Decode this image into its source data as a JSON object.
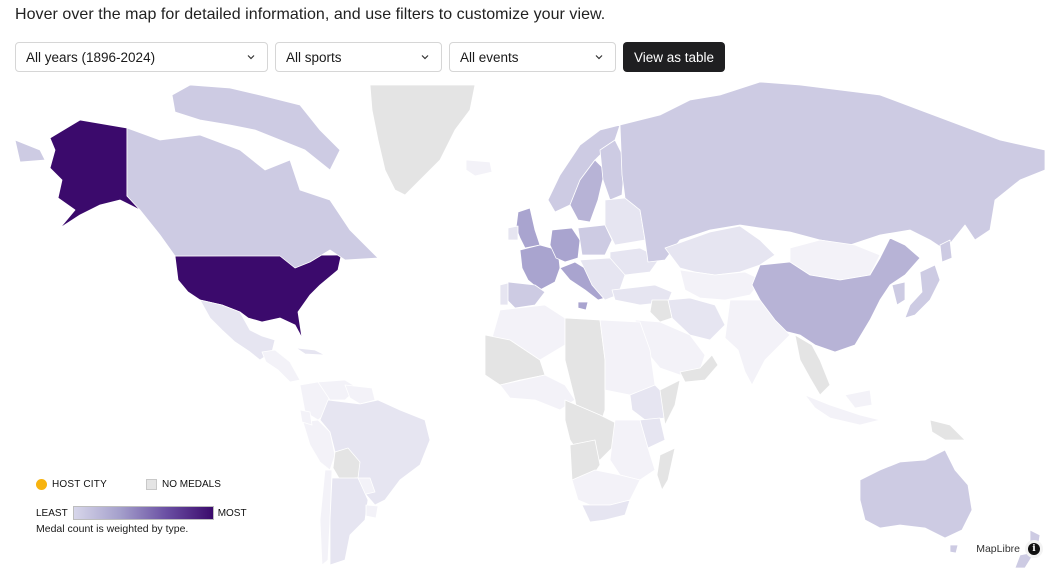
{
  "intro_text": "Hover over the map for detailed information, and use filters to customize your view.",
  "filters": {
    "years": {
      "selected": "All years (1896-2024)"
    },
    "sports": {
      "selected": "All sports"
    },
    "events": {
      "selected": "All events"
    },
    "view_table_label": "View as table"
  },
  "legend": {
    "host_city_label": "HOST CITY",
    "no_medals_label": "NO MEDALS",
    "least_label": "LEAST",
    "most_label": "MOST",
    "note": "Medal count is weighted by type."
  },
  "colors": {
    "host_city": "#f7b30f",
    "no_medals": "#e4e4e4",
    "scale": [
      "#f3f2f8",
      "#e6e5f1",
      "#cdcbe3",
      "#b7b3d6",
      "#a9a4cf",
      "#3b0a6c"
    ]
  },
  "attribution": {
    "label": "MapLibre",
    "info_icon": "i"
  },
  "countries": [
    {
      "name": "United States",
      "level": 5
    },
    {
      "name": "Alaska (United States)",
      "level": 5
    },
    {
      "name": "Canada",
      "level": 2
    },
    {
      "name": "Canadian Arctic Islands",
      "level": 2
    },
    {
      "name": "Greenland",
      "level": -1
    },
    {
      "name": "Iceland",
      "level": 0
    },
    {
      "name": "Mexico",
      "level": 1
    },
    {
      "name": "Central America",
      "level": 0
    },
    {
      "name": "Cuba",
      "level": 1
    },
    {
      "name": "Colombia",
      "level": 0
    },
    {
      "name": "Venezuela",
      "level": 0
    },
    {
      "name": "Guyana-Suriname",
      "level": 0
    },
    {
      "name": "Peru",
      "level": 0
    },
    {
      "name": "Ecuador",
      "level": 0
    },
    {
      "name": "Brazil",
      "level": 1
    },
    {
      "name": "Bolivia",
      "level": -1
    },
    {
      "name": "Paraguay",
      "level": 0
    },
    {
      "name": "Chile",
      "level": 0
    },
    {
      "name": "Argentina",
      "level": 1
    },
    {
      "name": "Uruguay",
      "level": 0
    },
    {
      "name": "United Kingdom",
      "level": 4
    },
    {
      "name": "Ireland",
      "level": 1
    },
    {
      "name": "France",
      "level": 4
    },
    {
      "name": "Spain",
      "level": 2
    },
    {
      "name": "Portugal",
      "level": 1
    },
    {
      "name": "Germany",
      "level": 4
    },
    {
      "name": "Italy",
      "level": 4
    },
    {
      "name": "Norway",
      "level": 2
    },
    {
      "name": "Sweden",
      "level": 3
    },
    {
      "name": "Finland",
      "level": 2
    },
    {
      "name": "Poland",
      "level": 2
    },
    {
      "name": "Ukraine",
      "level": 1
    },
    {
      "name": "Eastern Europe",
      "level": 1
    },
    {
      "name": "Balkans",
      "level": 1
    },
    {
      "name": "Turkey",
      "level": 1
    },
    {
      "name": "Russia",
      "level": 2
    },
    {
      "name": "Kazakhstan",
      "level": 1
    },
    {
      "name": "Central Asia",
      "level": 0
    },
    {
      "name": "Mongolia",
      "level": 0
    },
    {
      "name": "China",
      "level": 3
    },
    {
      "name": "Korea",
      "level": 2
    },
    {
      "name": "Japan",
      "level": 2
    },
    {
      "name": "Iran",
      "level": 1
    },
    {
      "name": "Iraq",
      "level": -1
    },
    {
      "name": "Arabia",
      "level": 0
    },
    {
      "name": "Yemen-Oman",
      "level": -1
    },
    {
      "name": "India",
      "level": 0
    },
    {
      "name": "Southeast Asia",
      "level": -1
    },
    {
      "name": "Indonesia",
      "level": 0
    },
    {
      "name": "Papua New Guinea",
      "level": -1
    },
    {
      "name": "Australia",
      "level": 2
    },
    {
      "name": "New Zealand",
      "level": 2
    },
    {
      "name": "North Africa West",
      "level": 0
    },
    {
      "name": "Libya-Chad",
      "level": -1
    },
    {
      "name": "Egypt-Sudan",
      "level": 0
    },
    {
      "name": "West Africa",
      "level": -1
    },
    {
      "name": "West Africa Coast",
      "level": 0
    },
    {
      "name": "Central Africa",
      "level": -1
    },
    {
      "name": "Ethiopia",
      "level": 1
    },
    {
      "name": "Kenya",
      "level": 1
    },
    {
      "name": "Somalia",
      "level": -1
    },
    {
      "name": "East Africa",
      "level": 0
    },
    {
      "name": "Angola",
      "level": -1
    },
    {
      "name": "Southern Africa",
      "level": 0
    },
    {
      "name": "South Africa",
      "level": 1
    },
    {
      "name": "Madagascar",
      "level": -1
    }
  ]
}
